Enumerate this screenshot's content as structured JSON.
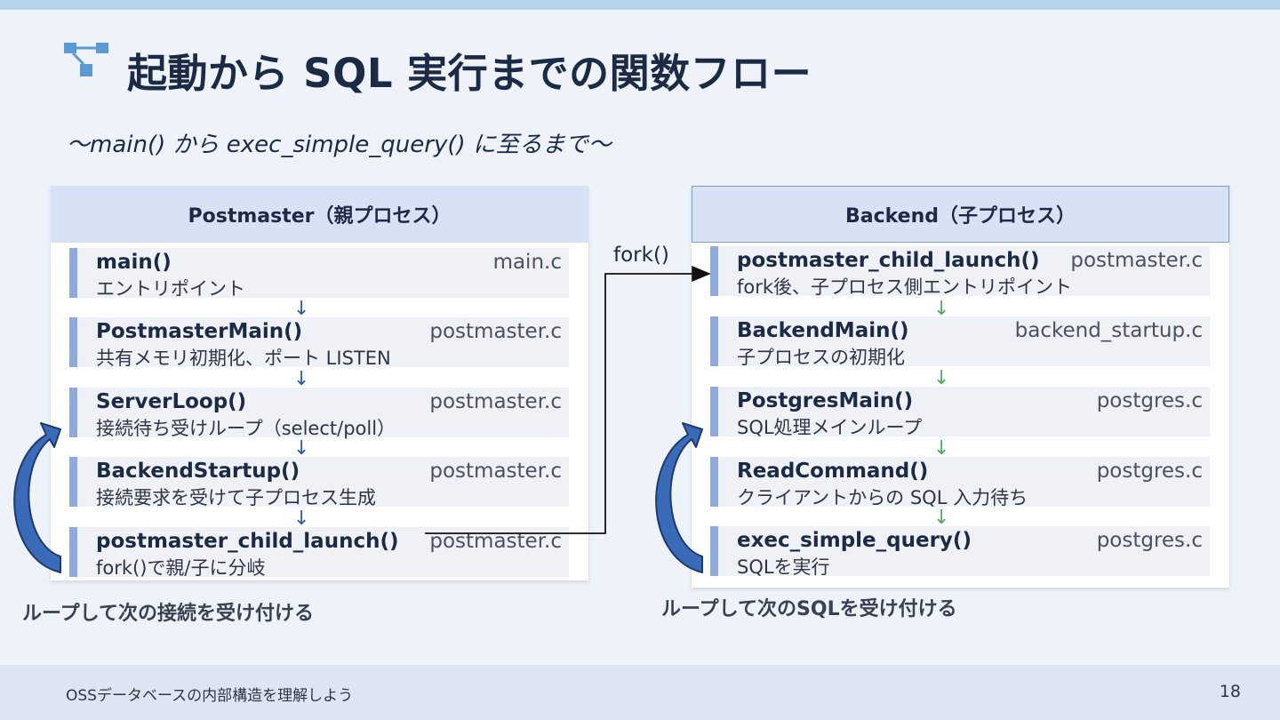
{
  "slide": {
    "title": "起動から SQL 実行までの関数フロー",
    "subtitle": "〜main() から exec_simple_query() に至るまで〜",
    "title_icon": "flow-diagram-icon",
    "accent_color": "#8ea9db",
    "header_fill": "#d7e3f4"
  },
  "postmaster": {
    "header": "Postmaster（親プロセス）",
    "functions": [
      {
        "name": "main()",
        "file": "main.c",
        "desc": "エントリポイント"
      },
      {
        "name": "PostmasterMain()",
        "file": "postmaster.c",
        "desc": "共有メモリ初期化、ポート LISTEN"
      },
      {
        "name": "ServerLoop()",
        "file": "postmaster.c",
        "desc": "接続待ち受けループ（select/poll）"
      },
      {
        "name": "BackendStartup()",
        "file": "postmaster.c",
        "desc": "接続要求を受けて子プロセス生成"
      },
      {
        "name": "postmaster_child_launch()",
        "file": "postmaster.c",
        "desc": "fork()で親/子に分岐"
      }
    ],
    "arrow": "↓",
    "loop_caption": "ループして次の接続を受け付ける"
  },
  "fork_label": "fork()",
  "backend": {
    "header": "Backend（子プロセス）",
    "functions": [
      {
        "name": "postmaster_child_launch()",
        "file": "postmaster.c",
        "desc": "fork後、子プロセス側エントリポイント"
      },
      {
        "name": "BackendMain()",
        "file": "backend_startup.c",
        "desc": "子プロセスの初期化"
      },
      {
        "name": "PostgresMain()",
        "file": "postgres.c",
        "desc": "SQL処理メインループ"
      },
      {
        "name": "ReadCommand()",
        "file": "postgres.c",
        "desc": "クライアントからの SQL 入力待ち"
      },
      {
        "name": "exec_simple_query()",
        "file": "postgres.c",
        "desc": "SQLを実行"
      }
    ],
    "arrow": "↓",
    "loop_caption": "ループして次のSQLを受け付ける"
  },
  "footer": {
    "text": "OSSデータベースの内部構造を理解しよう",
    "page": "18"
  }
}
